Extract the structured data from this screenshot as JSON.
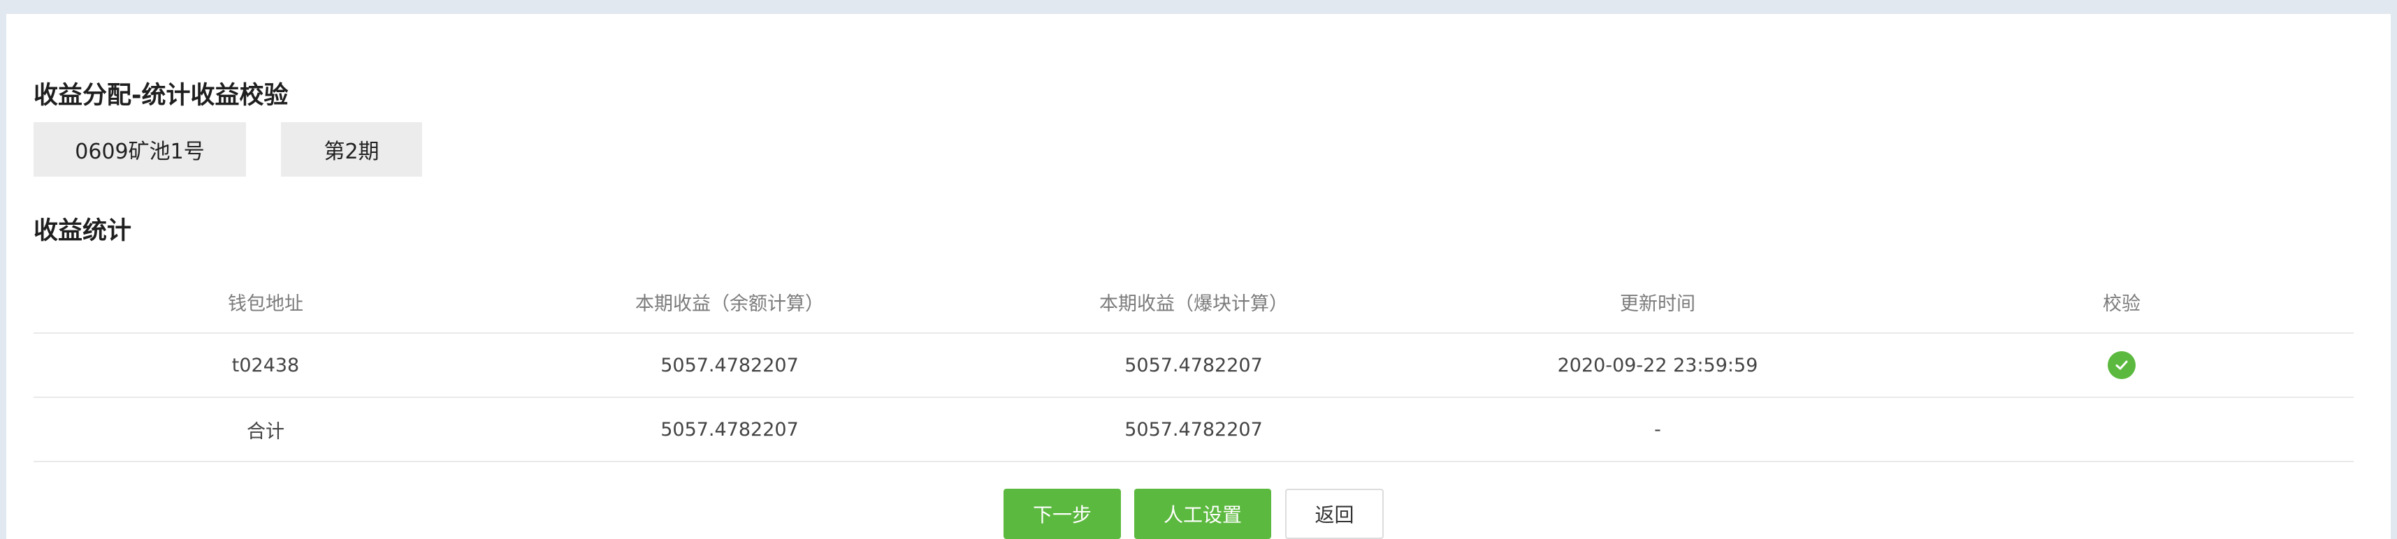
{
  "page": {
    "title": "收益分配-统计收益校验",
    "filters": {
      "pool": "0609矿池1号",
      "period": "第2期"
    }
  },
  "stats": {
    "title": "收益统计",
    "columns": [
      "钱包地址",
      "本期收益（余额计算）",
      "本期收益（爆块计算）",
      "更新时间",
      "校验"
    ],
    "rows": [
      {
        "wallet": "t02438",
        "income_balance": "5057.4782207",
        "income_block": "5057.4782207",
        "updated": "2020-09-22 23:59:59",
        "verified_icon": "check-circle-icon"
      }
    ],
    "total": {
      "label": "合计",
      "income_balance": "5057.4782207",
      "income_block": "5057.4782207",
      "updated": "-"
    }
  },
  "actions": {
    "next": "下一步",
    "manual": "人工设置",
    "back": "返回"
  },
  "colors": {
    "primary": "#5cb93f",
    "background": "#e1e8ef"
  }
}
